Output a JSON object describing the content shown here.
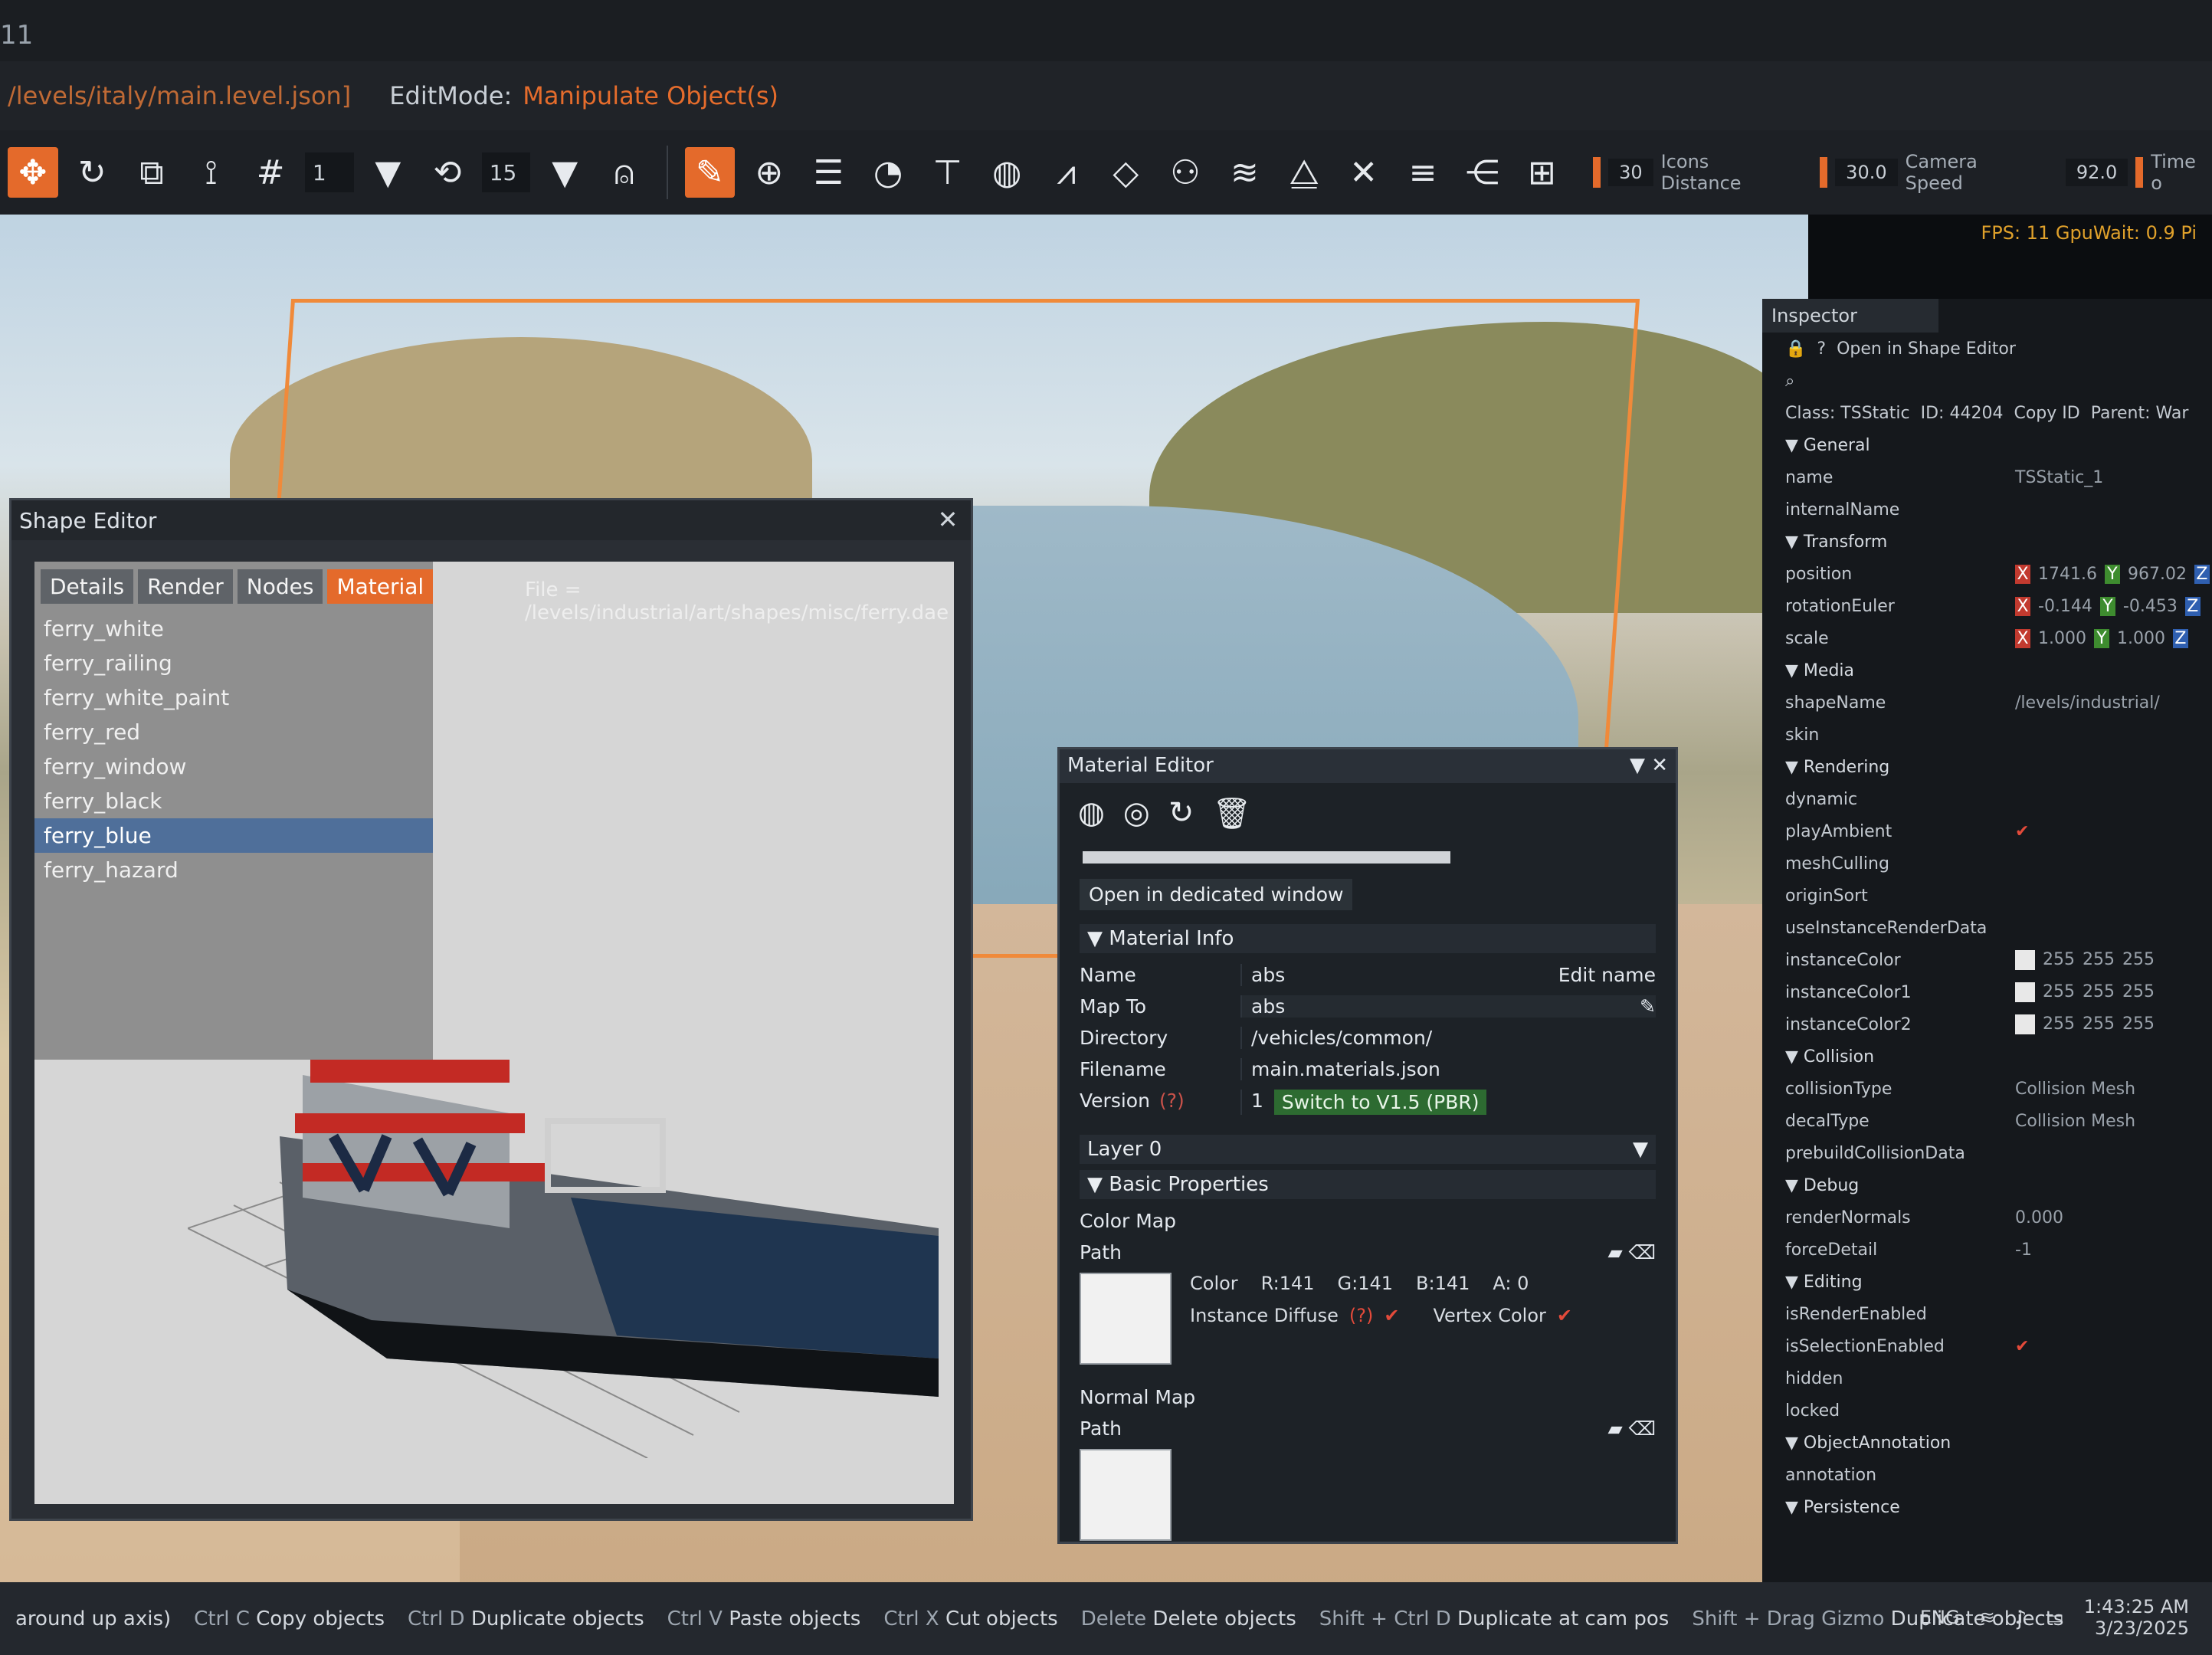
{
  "window": {
    "title_fragment": "11",
    "min_icon": "minimize-icon",
    "max_icon": "maximize-icon"
  },
  "menubar": {
    "level_path": "/levels/italy/main.level.json]",
    "editmode_label": "EditMode:",
    "editmode_value": "Manipulate Object(s)"
  },
  "toolbar": {
    "grid_size": "1",
    "rot_snap": "15",
    "stats": [
      {
        "value": "30",
        "label": "Icons Distance"
      },
      {
        "value": "30.0",
        "label": "Camera Speed"
      },
      {
        "value": "92.0",
        "label": "Time o"
      }
    ],
    "fps_text": "FPS: 11  GpuWait: 0.9  Pi"
  },
  "shape_editor": {
    "title": "Shape Editor",
    "tabs": [
      "Details",
      "Render",
      "Nodes",
      "Material"
    ],
    "active_tab": "Material",
    "file_label": "File = /levels/industrial/art/shapes/misc/ferry.dae",
    "materials": [
      "ferry_white",
      "ferry_railing",
      "ferry_white_paint",
      "ferry_red",
      "ferry_window",
      "ferry_black",
      "ferry_blue",
      "ferry_hazard"
    ],
    "selected": "ferry_blue"
  },
  "material_editor": {
    "title": "Material Editor",
    "open_dedicated": "Open in dedicated window",
    "material_info": "Material Info",
    "name_label": "Name",
    "name_value": "abs",
    "edit_name": "Edit name",
    "mapto_label": "Map To",
    "mapto_value": "abs",
    "dir_label": "Directory",
    "dir_value": "/vehicles/common/",
    "file_label": "Filename",
    "file_value": "main.materials.json",
    "version_label": "Version",
    "version_q": "(?)",
    "version_value": "1",
    "switch_btn": "Switch to V1.5 (PBR)",
    "layer": "Layer 0",
    "basic_props": "Basic Properties",
    "color_map": "Color Map",
    "path": "Path",
    "color_label": "Color",
    "r": "R:141",
    "g": "G:141",
    "b": "B:141",
    "a": "A: 0",
    "instance_diffuse": "Instance Diffuse",
    "id_q": "(?)",
    "vertex_color": "Vertex Color",
    "normal_map": "Normal Map",
    "normal_path": "Path"
  },
  "inspector": {
    "title": "Inspector",
    "open_shape": "Open in Shape Editor",
    "class_label": "Class:",
    "class_value": "TSStatic",
    "id_label": "ID:",
    "id_value": "44204",
    "copy_id": "Copy ID",
    "parent": "Parent:",
    "parent_value": "War",
    "general": "General",
    "name_k": "name",
    "name_v": "TSStatic_1",
    "internal": "internalName",
    "transform": "Transform",
    "position": "position",
    "pos_x": "1741.6",
    "pos_y": "967.02",
    "rotation": "rotationEuler",
    "rot_x": "-0.144",
    "rot_y": "-0.453",
    "scale": "scale",
    "sc_x": "1.000",
    "sc_y": "1.000",
    "media": "Media",
    "shapeName": "shapeName",
    "shapeName_v": "/levels/industrial/",
    "skin": "skin",
    "rendering": "Rendering",
    "dynamic": "dynamic",
    "playAmbient": "playAmbient",
    "meshCulling": "meshCulling",
    "originSort": "originSort",
    "useInstanceRenderData": "useInstanceRenderData",
    "instanceColor": "instanceColor",
    "instanceColor1": "instanceColor1",
    "instanceColor2": "instanceColor2",
    "c255": "255",
    "collision": "Collision",
    "collisionType": "collisionType",
    "collisionType_v": "Collision Mesh",
    "decalType": "decalType",
    "decalType_v": "Collision Mesh",
    "prebuild": "prebuildCollisionData",
    "debug": "Debug",
    "renderNormals": "renderNormals",
    "renderNormals_v": "0.000",
    "forceDetail": "forceDetail",
    "forceDetail_v": "-1",
    "editing": "Editing",
    "isRenderEnabled": "isRenderEnabled",
    "isSelectionEnabled": "isSelectionEnabled",
    "hidden": "hidden",
    "locked": "locked",
    "objAnno": "ObjectAnnotation",
    "annotation": "annotation",
    "persistence": "Persistence"
  },
  "statusbar": {
    "items": [
      {
        "key": "",
        "label": "around up axis)"
      },
      {
        "key": "Ctrl C",
        "label": "Copy objects"
      },
      {
        "key": "Ctrl D",
        "label": "Duplicate objects"
      },
      {
        "key": "Ctrl V",
        "label": "Paste objects"
      },
      {
        "key": "Ctrl X",
        "label": "Cut objects"
      },
      {
        "key": "Delete",
        "label": "Delete objects"
      },
      {
        "key": "Shift + Ctrl D",
        "label": "Duplicate at cam pos"
      },
      {
        "key": "Shift + Drag Gizmo",
        "label": "Duplicate objects"
      }
    ],
    "lang": "ENG",
    "time": "1:43:25 AM",
    "date": "3/23/2025"
  }
}
